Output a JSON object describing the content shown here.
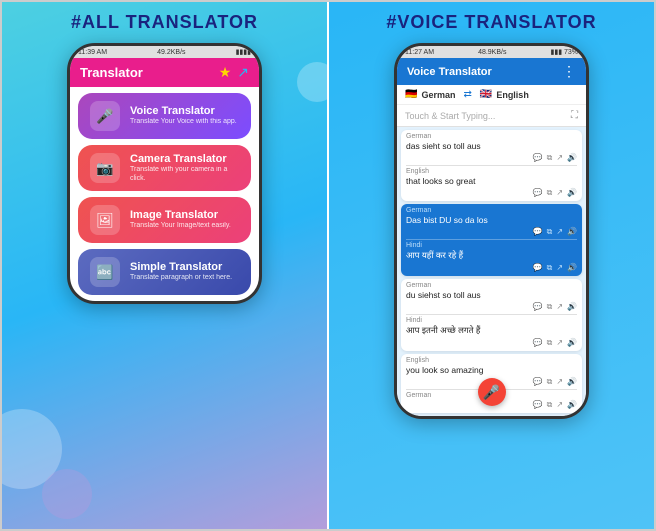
{
  "left_panel": {
    "title": "#ALL TRANSLATOR",
    "phone": {
      "status_bar": {
        "time": "11:39 AM",
        "stats": "49.2KB/s",
        "battery": "⬤"
      },
      "header": {
        "title": "Translator",
        "star_icon": "★",
        "share_icon": "↗"
      },
      "menu_items": [
        {
          "id": "voice",
          "icon": "🎤",
          "title": "Voice Translator",
          "subtitle": "Translate Your Voice with this app.",
          "class": "menu-item-voice"
        },
        {
          "id": "camera",
          "icon": "📷",
          "title": "Camera Translator",
          "subtitle": "Translate with your camera in a click.",
          "class": "menu-item-camera"
        },
        {
          "id": "image",
          "icon": "🖼",
          "title": "Image Translator",
          "subtitle": "Translate Your Image/text easily.",
          "class": "menu-item-image"
        },
        {
          "id": "simple",
          "icon": "🔤",
          "title": "Simple Translator",
          "subtitle": "Translate paragraph or text here.",
          "class": "menu-item-simple"
        }
      ]
    }
  },
  "right_panel": {
    "title": "#VOICE TRANSLATOR",
    "phone": {
      "status_bar": {
        "time": "11:27 AM",
        "stats": "48.9KB/s",
        "battery": "73"
      },
      "header": {
        "title": "Voice Translator",
        "menu_icon": "⋮"
      },
      "lang_bar": {
        "from_flag": "🇩🇪",
        "from_lang": "German",
        "to_flag": "🇬🇧",
        "to_lang": "English",
        "swap_icon": "⇄"
      },
      "typing_placeholder": "Touch & Start Typing...",
      "translations": [
        {
          "from_lang": "German",
          "from_text": "das sieht so toll aus",
          "to_lang": "English",
          "to_text": "that looks so great",
          "highlight": false
        },
        {
          "from_lang": "German",
          "from_text": "Das bist DU so da los",
          "to_lang": "Hindi",
          "to_text": "आप यहीं कर रहे हैं",
          "highlight": true
        },
        {
          "from_lang": "German",
          "from_text": "du siehst so toll aus",
          "to_lang": "Hindi",
          "to_text": "आप इतनी अच्छे लगते हैं",
          "highlight": false
        },
        {
          "from_lang": "English",
          "from_text": "you look so amazing",
          "to_lang": "German",
          "to_text": "",
          "highlight": false
        }
      ],
      "mic_icon": "🎤"
    }
  }
}
